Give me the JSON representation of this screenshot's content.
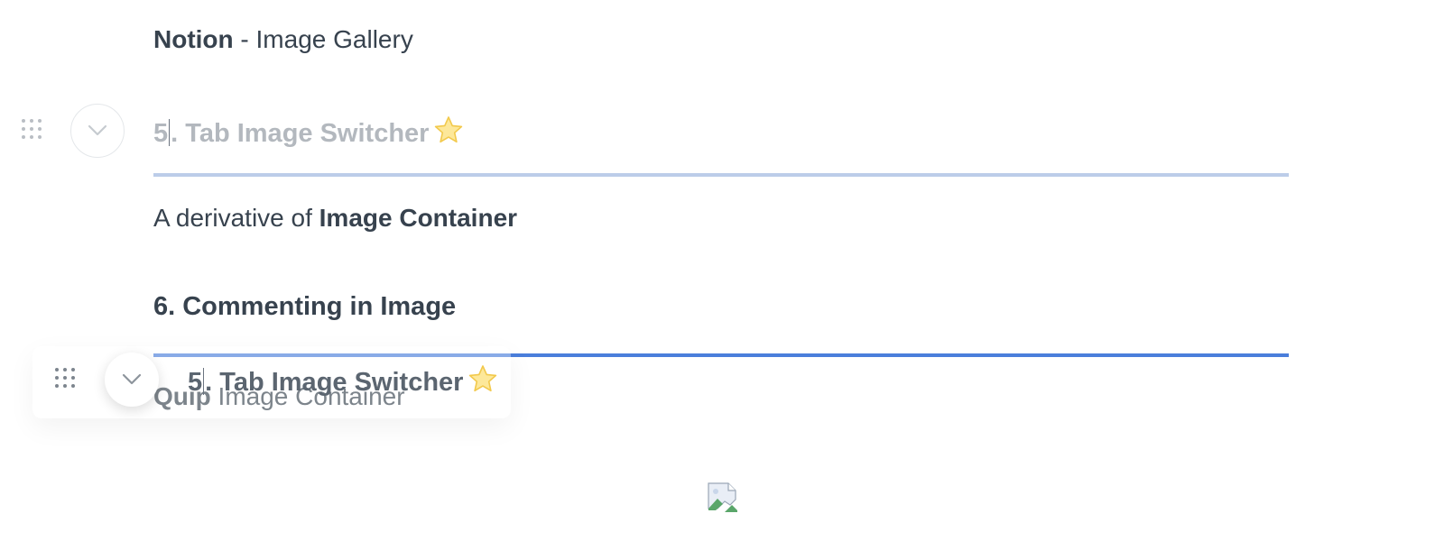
{
  "gallery_title": {
    "bold": "Notion",
    "rest": " - Image Gallery"
  },
  "heading_ghost": {
    "number": "5",
    "rest": ". Tab Image Switcher"
  },
  "derivative": {
    "prefix": "A derivative of ",
    "bold": "Image Container"
  },
  "heading_six": {
    "text": "6. Commenting in Image"
  },
  "dragged_heading": {
    "number": "5",
    "rest": ". Tab Image Switcher"
  },
  "quip_line": {
    "bold": "Quip",
    "rest": " Image Container"
  },
  "icons": {
    "drag_handle": "drag-handle-icon",
    "toggle": "chevron-down-icon",
    "star": "star-emoji",
    "broken_image": "broken-image-icon"
  },
  "colors": {
    "drop_indicator": "#4a7edb",
    "ghost_underline": "#bccde9",
    "ghost_text": "#b3b8be"
  }
}
